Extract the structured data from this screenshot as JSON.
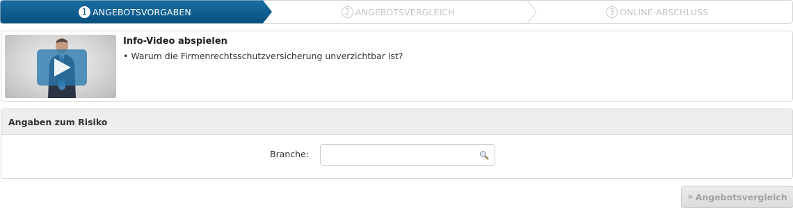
{
  "stepper": {
    "steps": [
      {
        "number": "1",
        "label": "ANGEBOTSVORGABEN",
        "state": "active"
      },
      {
        "number": "2",
        "label": "ANGEBOTSVERGLEICH",
        "state": "inactive"
      },
      {
        "number": "3",
        "label": "ONLINE-ABSCHLUSS",
        "state": "inactive"
      }
    ]
  },
  "info_video": {
    "title": "Info-Video abspielen",
    "bullet": "Warum die Firmenrechtsschutzversicherung unverzichtbar ist?"
  },
  "risk": {
    "header": "Angaben zum Risiko",
    "branche_label": "Branche:",
    "branche_value": "",
    "branche_placeholder": ""
  },
  "actions": {
    "submit_label": "Angebotsvergleich"
  },
  "colors": {
    "active_step": "#0a5a8c",
    "inactive_text": "#c4c4c4"
  }
}
